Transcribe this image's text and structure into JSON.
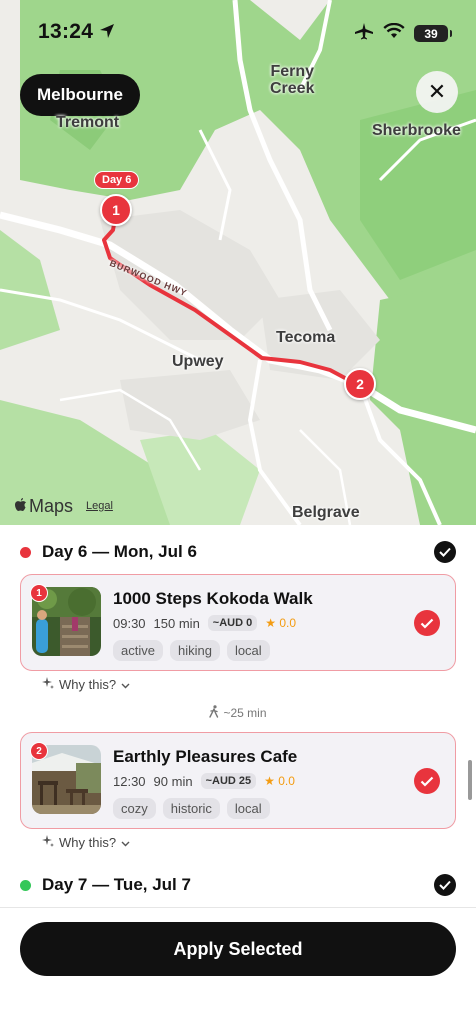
{
  "status_bar": {
    "time": "13:24",
    "battery": "39"
  },
  "map": {
    "city_button": "Melbourne",
    "labels": {
      "tremont": "Tremont",
      "ferny_creek": "Ferny\nCreek",
      "sherbrooke": "Sherbrooke",
      "burwood": "BURWOOD HWY",
      "tecoma": "Tecoma",
      "upwey": "Upwey",
      "belgrave": "Belgrave"
    },
    "day_tag": "Day 6",
    "pin_1": "1",
    "pin_2": "2",
    "brand": "Maps",
    "legal": "Legal"
  },
  "days": [
    {
      "title": "Day 6 — Mon, Jul 6",
      "color": "#e8343d",
      "stops": [
        {
          "index": "1",
          "title": "1000 Steps Kokoda Walk",
          "time": "09:30",
          "duration": "150 min",
          "price": "~AUD 0",
          "rating": "★ 0.0",
          "tags": [
            "active",
            "hiking",
            "local"
          ],
          "why": "Why this?"
        },
        {
          "index": "2",
          "title": "Earthly Pleasures Cafe",
          "time": "12:30",
          "duration": "90 min",
          "price": "~AUD 25",
          "rating": "★ 0.0",
          "tags": [
            "cozy",
            "historic",
            "local"
          ],
          "why": "Why this?"
        }
      ],
      "travel": "~25 min"
    },
    {
      "title": "Day 7 — Tue, Jul 7",
      "color": "#34c759"
    }
  ],
  "apply_button": "Apply Selected"
}
